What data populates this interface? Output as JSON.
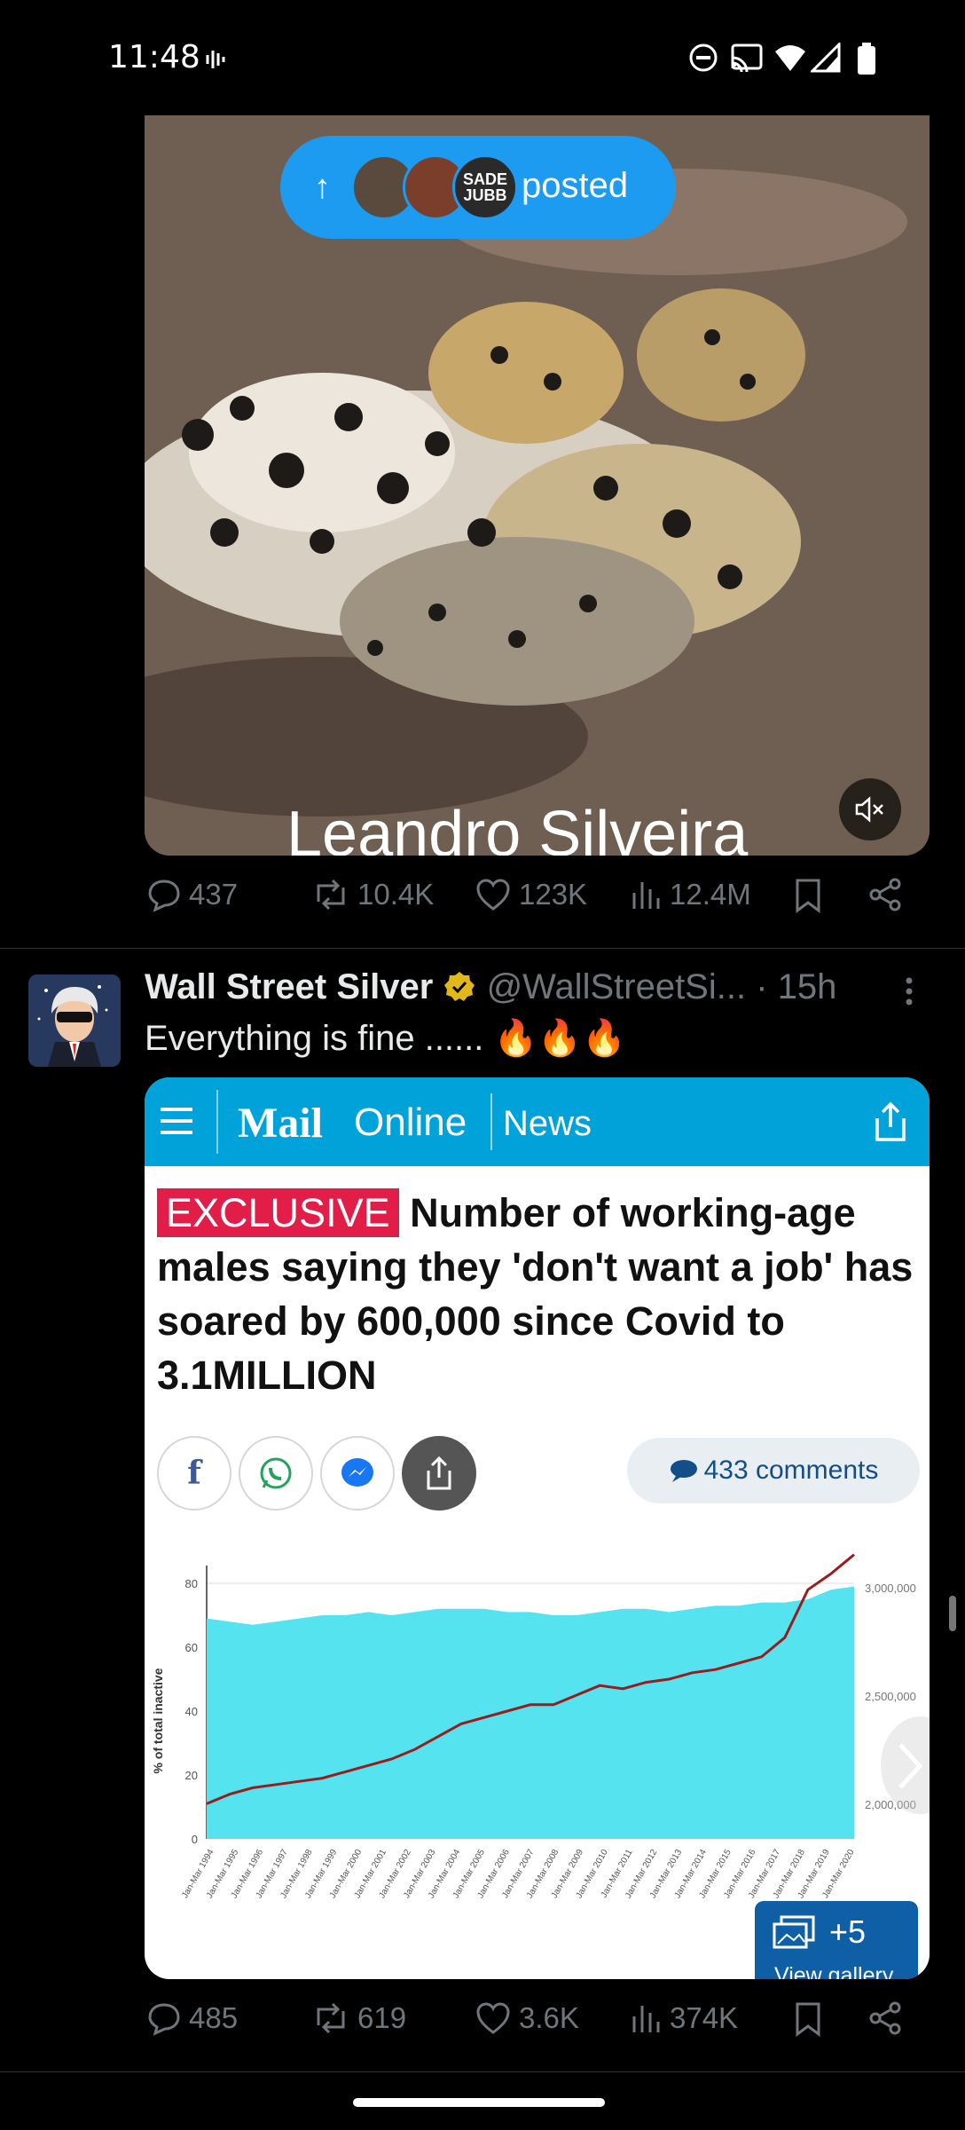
{
  "status_bar": {
    "time": "11:48"
  },
  "pill": {
    "label": "posted",
    "avatar_text": "SADE JUBB"
  },
  "video": {
    "caption": "Leandro Silveira"
  },
  "tweet1_metrics": {
    "replies": "437",
    "reposts": "10.4K",
    "likes": "123K",
    "views": "12.4M"
  },
  "tweet2": {
    "name": "Wall Street Silver",
    "handle": "@WallStreetSi...",
    "dot": "·",
    "time": "15h",
    "text": "Everything is fine ...... 🔥🔥🔥",
    "metrics": {
      "replies": "485",
      "reposts": "619",
      "likes": "3.6K",
      "views": "374K"
    }
  },
  "card": {
    "brand_bold": "Mail",
    "brand_light": "Online",
    "section": "News",
    "exclusive": "EXCLUSIVE",
    "headline": "Number of working-age males saying they 'don't want a job' has soared by 600,000 since Covid to 3.1MILLION",
    "comments": "433 comments",
    "gallery_count": "+5",
    "gallery_label": "View gallery"
  },
  "chart_data": {
    "type": "line",
    "ylabel": "% of total inactive",
    "ylim": [
      0,
      80
    ],
    "y_ticks": [
      "0",
      "20",
      "40",
      "60",
      "80"
    ],
    "right_ticks": [
      "3,000,000",
      "2,500,000",
      "2,000,000"
    ],
    "x_ticks": [
      "Jan-Mar 1994",
      "Jan-Mar 1995",
      "Jan-Mar 1996",
      "Jan-Mar 1997",
      "Jan-Mar 1998",
      "Jan-Mar 1999",
      "Jan-Mar 2000",
      "Jan-Mar 2001",
      "Jan-Mar 2002",
      "Jan-Mar 2003",
      "Jan-Mar 2004",
      "Jan-Mar 2005",
      "Jan-Mar 2006",
      "Jan-Mar 2007",
      "Jan-Mar 2008",
      "Jan-Mar 2009",
      "Jan-Mar 2010",
      "Jan-Mar 2011",
      "Jan-Mar 2012",
      "Jan-Mar 2013",
      "Jan-Mar 2014",
      "Jan-Mar 2015",
      "Jan-Mar 2016",
      "Jan-Mar 2017",
      "Jan-Mar 2018",
      "Jan-Mar 2019",
      "Jan-Mar 2020"
    ],
    "series": [
      {
        "values": [
          69,
          68,
          67,
          68,
          69,
          70,
          70,
          71,
          70,
          71,
          72,
          72,
          72,
          71,
          71,
          70,
          70,
          71,
          72,
          72,
          71,
          72,
          73,
          73,
          74,
          74,
          75,
          78,
          79
        ]
      },
      {
        "values": [
          11,
          14,
          16,
          17,
          18,
          19,
          21,
          23,
          25,
          28,
          32,
          36,
          38,
          40,
          42,
          42,
          45,
          48,
          47,
          49,
          50,
          52,
          53,
          55,
          57,
          63,
          78,
          83,
          89
        ]
      }
    ],
    "colors": {
      "area": "#56e3f0",
      "line": "#9b1c1c"
    }
  }
}
